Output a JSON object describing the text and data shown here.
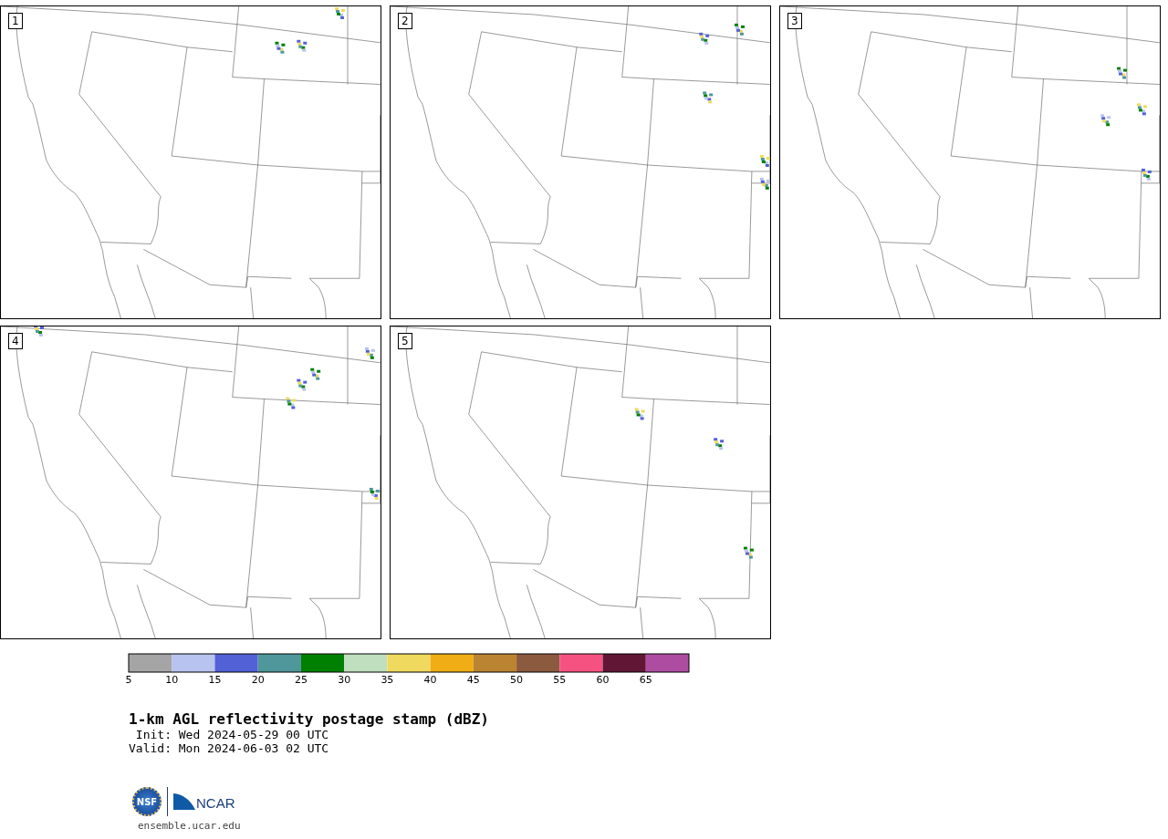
{
  "panels": [
    {
      "label": "1"
    },
    {
      "label": "2"
    },
    {
      "label": "3"
    },
    {
      "label": "4"
    },
    {
      "label": "5"
    }
  ],
  "colorbar": {
    "bins": [
      {
        "color": "#a5a5a5"
      },
      {
        "color": "#b8c3ef"
      },
      {
        "color": "#5261d6"
      },
      {
        "color": "#4f979b"
      },
      {
        "color": "#008000"
      },
      {
        "color": "#bfdfbf"
      },
      {
        "color": "#efda5f"
      },
      {
        "color": "#f0ad15"
      },
      {
        "color": "#bb8432"
      },
      {
        "color": "#8b5a3f"
      },
      {
        "color": "#f65281"
      },
      {
        "color": "#601634"
      },
      {
        "color": "#ae4ca2"
      }
    ],
    "ticks": [
      "5",
      "10",
      "15",
      "20",
      "25",
      "30",
      "35",
      "40",
      "45",
      "50",
      "55",
      "60",
      "65"
    ]
  },
  "title": "1-km AGL reflectivity postage stamp (dBZ)",
  "init": " Init: Wed 2024-05-29 00 UTC",
  "valid": "Valid: Mon 2024-06-03 02 UTC",
  "logos": {
    "nsf": "NSF",
    "ncar": "NCAR"
  },
  "url": "ensemble.ucar.edu"
}
